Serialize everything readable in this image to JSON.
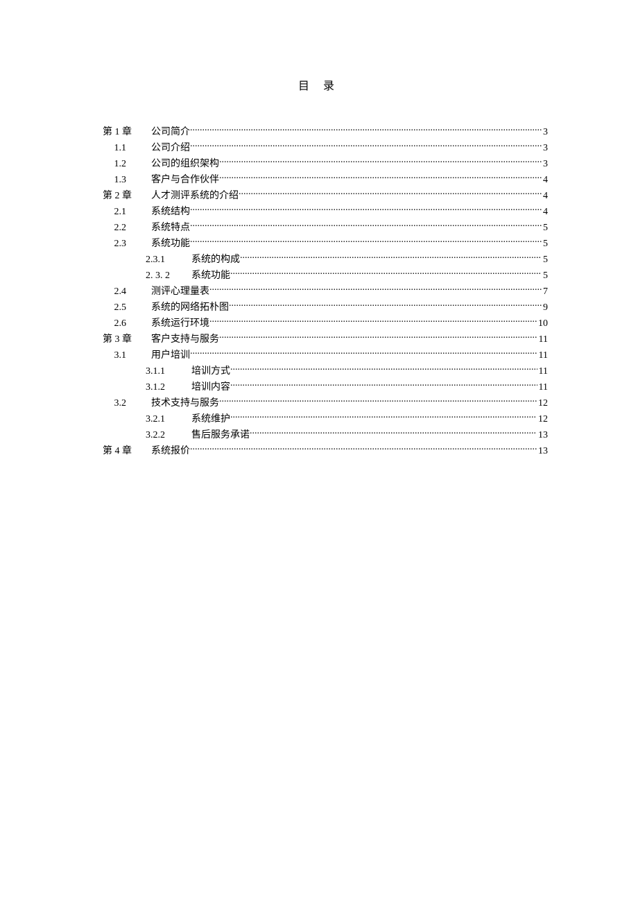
{
  "title": "目  录",
  "entries": [
    {
      "level": 1,
      "label": "第 1 章",
      "text": "公司简介",
      "page": "3"
    },
    {
      "level": 2,
      "label": "1.1",
      "text": "公司介绍",
      "page": "3"
    },
    {
      "level": 2,
      "label": "1.2",
      "text": "公司的组织架构",
      "page": "3"
    },
    {
      "level": 2,
      "label": "1.3",
      "text": "客户与合作伙伴",
      "page": "4"
    },
    {
      "level": 1,
      "label": "第 2 章",
      "text": "人才测评系统的介绍",
      "page": "4"
    },
    {
      "level": 2,
      "label": "2.1",
      "text": "系统结构",
      "page": "4"
    },
    {
      "level": 2,
      "label": "2.2",
      "text": "系统特点",
      "page": "5"
    },
    {
      "level": 2,
      "label": "2.3",
      "text": "系统功能",
      "page": "5"
    },
    {
      "level": 3,
      "label": "2.3.1",
      "text": "系统的构成",
      "page": "5"
    },
    {
      "level": 3,
      "label": "2. 3. 2",
      "text": "系统功能",
      "page": "5"
    },
    {
      "level": 2,
      "label": "2.4",
      "text": "测评心理量表",
      "page": "7"
    },
    {
      "level": 2,
      "label": "2.5",
      "text": "系统的网络拓朴图",
      "page": "9"
    },
    {
      "level": 2,
      "label": "2.6",
      "text": "系统运行环境",
      "page": "10"
    },
    {
      "level": 1,
      "label": "第 3 章",
      "text": "客户支持与服务",
      "page": "11"
    },
    {
      "level": 2,
      "label": "3.1",
      "text": "用户培训",
      "page": "11"
    },
    {
      "level": 3,
      "label": "3.1.1",
      "text": "培训方式",
      "page": "11"
    },
    {
      "level": 3,
      "label": "3.1.2",
      "text": "培训内容",
      "page": "11"
    },
    {
      "level": 2,
      "label": "3.2",
      "text": "技术支持与服务",
      "page": "12"
    },
    {
      "level": 3,
      "label": "3.2.1",
      "text": "系统维护",
      "page": "12"
    },
    {
      "level": 3,
      "label": "3.2.2",
      "text": "售后服务承诺",
      "page": "13"
    },
    {
      "level": 1,
      "label": "第 4 章",
      "text": "系统报价",
      "page": "13"
    }
  ]
}
